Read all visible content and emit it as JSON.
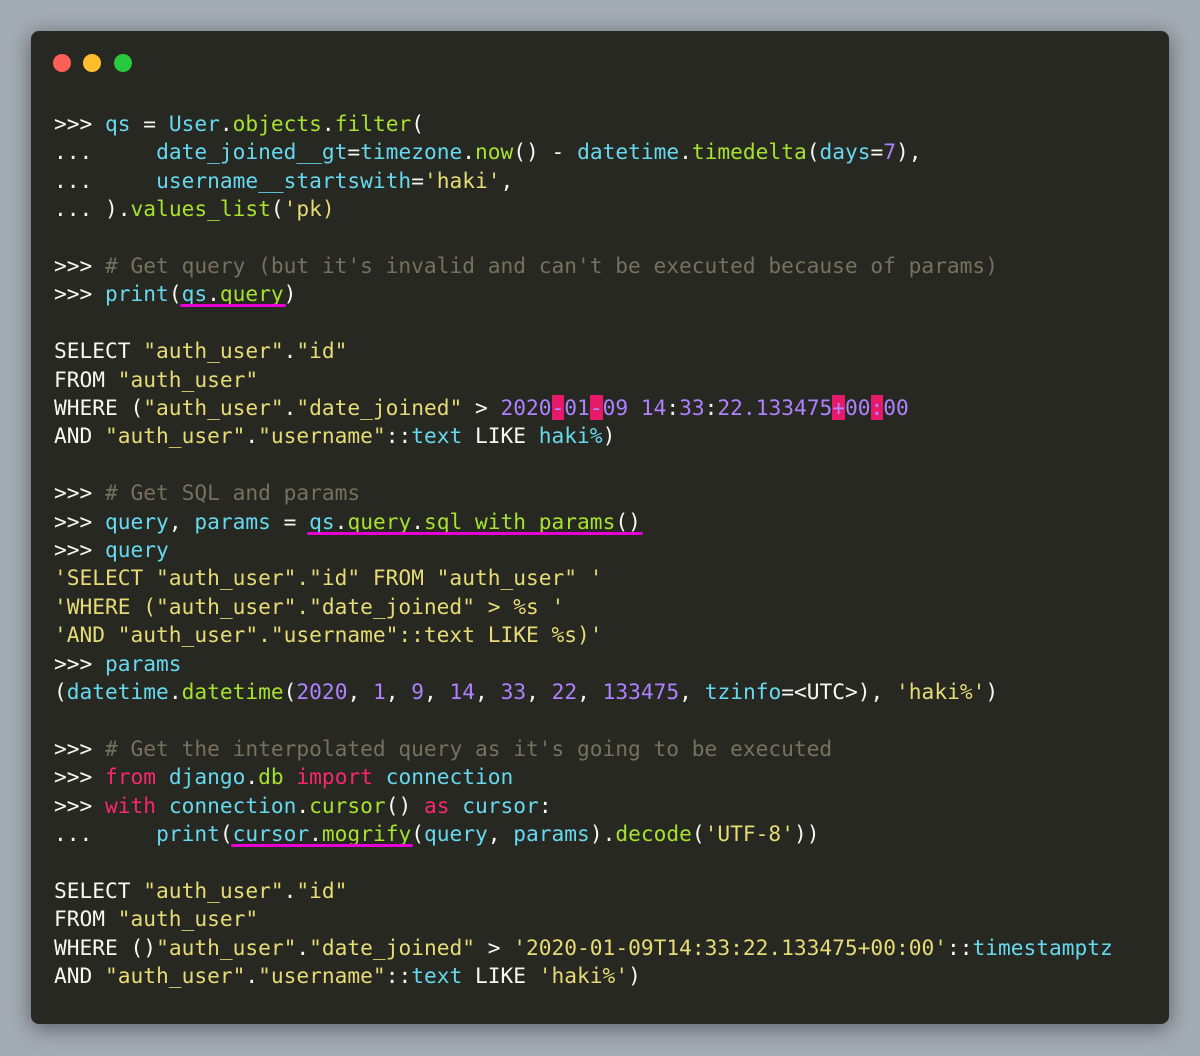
{
  "window": {
    "controls": [
      "close",
      "minimize",
      "maximize"
    ]
  },
  "code_lines": [
    [
      [
        "pr",
        ">>> "
      ],
      [
        "cy",
        "qs"
      ],
      [
        "pr",
        " = "
      ],
      [
        "cy",
        "User"
      ],
      [
        "pr",
        "."
      ],
      [
        "gr",
        "objects"
      ],
      [
        "pr",
        "."
      ],
      [
        "gr",
        "filter"
      ],
      [
        "pr",
        "("
      ]
    ],
    [
      [
        "pr",
        "...     "
      ],
      [
        "cy",
        "date_joined__gt"
      ],
      [
        "pr",
        "="
      ],
      [
        "cy",
        "timezone"
      ],
      [
        "pr",
        "."
      ],
      [
        "gr",
        "now"
      ],
      [
        "pr",
        "() - "
      ],
      [
        "cy",
        "datetime"
      ],
      [
        "pr",
        "."
      ],
      [
        "gr",
        "timedelta"
      ],
      [
        "pr",
        "("
      ],
      [
        "cy",
        "days"
      ],
      [
        "pr",
        "="
      ],
      [
        "pu",
        "7"
      ],
      [
        "pr",
        "),"
      ]
    ],
    [
      [
        "pr",
        "...     "
      ],
      [
        "cy",
        "username__startswith"
      ],
      [
        "pr",
        "="
      ],
      [
        "yl",
        "'haki'"
      ],
      [
        "pr",
        ","
      ]
    ],
    [
      [
        "pr",
        "... )."
      ],
      [
        "gr",
        "values_list"
      ],
      [
        "pr",
        "("
      ],
      [
        "yl",
        "'pk)"
      ]
    ],
    [],
    [
      [
        "pr",
        ">>> "
      ],
      [
        "cm",
        "# Get query (but it's invalid and can't be executed because of params)"
      ]
    ],
    [
      [
        "pr",
        ">>> "
      ],
      [
        "cy",
        "print"
      ],
      [
        "pr",
        "("
      ],
      [
        "cy",
        "qs"
      ],
      [
        "pr",
        "."
      ],
      [
        "gr",
        "query"
      ],
      [
        "pr",
        ")"
      ]
    ],
    [],
    [
      [
        "pr",
        "SELECT "
      ],
      [
        "yl",
        "\"auth_user\""
      ],
      [
        "pr",
        "."
      ],
      [
        "yl",
        "\"id\""
      ]
    ],
    [
      [
        "pr",
        "FROM "
      ],
      [
        "yl",
        "\"auth_user\""
      ]
    ],
    [
      [
        "pr",
        "WHERE ("
      ],
      [
        "yl",
        "\"auth_user\""
      ],
      [
        "pr",
        "."
      ],
      [
        "yl",
        "\"date_joined\""
      ],
      [
        "pr",
        " > "
      ],
      [
        "pu",
        "2020"
      ],
      [
        "hl",
        "-"
      ],
      [
        "pu",
        "01"
      ],
      [
        "hl",
        "-"
      ],
      [
        "pu",
        "09"
      ],
      [
        "pr",
        " "
      ],
      [
        "pu",
        "14"
      ],
      [
        "pr",
        ":"
      ],
      [
        "pu",
        "33"
      ],
      [
        "pr",
        ":"
      ],
      [
        "pu",
        "22.133475"
      ],
      [
        "hl",
        "+"
      ],
      [
        "pu",
        "00"
      ],
      [
        "hl",
        ":"
      ],
      [
        "pu",
        "00"
      ]
    ],
    [
      [
        "pr",
        "AND "
      ],
      [
        "yl",
        "\"auth_user\""
      ],
      [
        "pr",
        "."
      ],
      [
        "yl",
        "\"username\""
      ],
      [
        "pr",
        "::"
      ],
      [
        "cy",
        "text"
      ],
      [
        "pr",
        " LIKE "
      ],
      [
        "cy",
        "haki%"
      ],
      [
        "pr",
        ")"
      ]
    ],
    [],
    [
      [
        "pr",
        ">>> "
      ],
      [
        "cm",
        "# Get SQL and params"
      ]
    ],
    [
      [
        "pr",
        ">>> "
      ],
      [
        "cy",
        "query"
      ],
      [
        "pr",
        ", "
      ],
      [
        "cy",
        "params"
      ],
      [
        "pr",
        " = "
      ],
      [
        "cy",
        "qs"
      ],
      [
        "pr",
        "."
      ],
      [
        "gr",
        "query"
      ],
      [
        "pr",
        "."
      ],
      [
        "gr",
        "sql_with_params"
      ],
      [
        "pr",
        "()"
      ]
    ],
    [
      [
        "pr",
        ">>> "
      ],
      [
        "cy",
        "query"
      ]
    ],
    [
      [
        "yl",
        "'SELECT \"auth_user\".\"id\" FROM \"auth_user\" '"
      ]
    ],
    [
      [
        "yl",
        "'WHERE (\"auth_user\".\"date_joined\" > %s '"
      ]
    ],
    [
      [
        "yl",
        "'AND \"auth_user\".\"username\"::text LIKE %s)'"
      ]
    ],
    [
      [
        "pr",
        ">>> "
      ],
      [
        "cy",
        "params"
      ]
    ],
    [
      [
        "pr",
        "("
      ],
      [
        "cy",
        "datetime"
      ],
      [
        "pr",
        "."
      ],
      [
        "gr",
        "datetime"
      ],
      [
        "pr",
        "("
      ],
      [
        "pu",
        "2020"
      ],
      [
        "pr",
        ", "
      ],
      [
        "pu",
        "1"
      ],
      [
        "pr",
        ", "
      ],
      [
        "pu",
        "9"
      ],
      [
        "pr",
        ", "
      ],
      [
        "pu",
        "14"
      ],
      [
        "pr",
        ", "
      ],
      [
        "pu",
        "33"
      ],
      [
        "pr",
        ", "
      ],
      [
        "pu",
        "22"
      ],
      [
        "pr",
        ", "
      ],
      [
        "pu",
        "133475"
      ],
      [
        "pr",
        ", "
      ],
      [
        "cy",
        "tzinfo"
      ],
      [
        "pr",
        "=<UTC>), "
      ],
      [
        "yl",
        "'haki%'"
      ],
      [
        "pr",
        ")"
      ]
    ],
    [],
    [
      [
        "pr",
        ">>> "
      ],
      [
        "cm",
        "# Get the interpolated query as it's going to be executed"
      ]
    ],
    [
      [
        "pr",
        ">>> "
      ],
      [
        "pk",
        "from"
      ],
      [
        "pr",
        " "
      ],
      [
        "cy",
        "django"
      ],
      [
        "pr",
        "."
      ],
      [
        "gr",
        "db"
      ],
      [
        "pr",
        " "
      ],
      [
        "pk",
        "import"
      ],
      [
        "pr",
        " "
      ],
      [
        "cy",
        "connection"
      ]
    ],
    [
      [
        "pr",
        ">>> "
      ],
      [
        "pk",
        "with"
      ],
      [
        "pr",
        " "
      ],
      [
        "cy",
        "connection"
      ],
      [
        "pr",
        "."
      ],
      [
        "gr",
        "cursor"
      ],
      [
        "pr",
        "() "
      ],
      [
        "pk",
        "as"
      ],
      [
        "pr",
        " "
      ],
      [
        "cy",
        "cursor"
      ],
      [
        "pr",
        ":"
      ]
    ],
    [
      [
        "pr",
        "...     "
      ],
      [
        "cy",
        "print"
      ],
      [
        "pr",
        "("
      ],
      [
        "cy",
        "cursor"
      ],
      [
        "pr",
        "."
      ],
      [
        "gr",
        "mogrify"
      ],
      [
        "pr",
        "("
      ],
      [
        "cy",
        "query"
      ],
      [
        "pr",
        ", "
      ],
      [
        "cy",
        "params"
      ],
      [
        "pr",
        ")."
      ],
      [
        "gr",
        "decode"
      ],
      [
        "pr",
        "("
      ],
      [
        "yl",
        "'UTF-8'"
      ],
      [
        "pr",
        "))"
      ]
    ],
    [],
    [
      [
        "pr",
        "SELECT "
      ],
      [
        "yl",
        "\"auth_user\""
      ],
      [
        "pr",
        "."
      ],
      [
        "yl",
        "\"id\""
      ]
    ],
    [
      [
        "pr",
        "FROM "
      ],
      [
        "yl",
        "\"auth_user\""
      ]
    ],
    [
      [
        "pr",
        "WHERE ()"
      ],
      [
        "yl",
        "\"auth_user\""
      ],
      [
        "pr",
        "."
      ],
      [
        "yl",
        "\"date_joined\""
      ],
      [
        "pr",
        " > "
      ],
      [
        "yl",
        "'2020-01-09T14:33:22.133475+00:00'"
      ],
      [
        "pr",
        "::"
      ],
      [
        "cy",
        "timestamptz"
      ]
    ],
    [
      [
        "pr",
        "AND "
      ],
      [
        "yl",
        "\"auth_user\""
      ],
      [
        "pr",
        "."
      ],
      [
        "yl",
        "\"username\""
      ],
      [
        "pr",
        "::"
      ],
      [
        "cy",
        "text"
      ],
      [
        "pr",
        " LIKE "
      ],
      [
        "yl",
        "'haki%'"
      ],
      [
        "pr",
        ")"
      ]
    ]
  ],
  "underlines": [
    {
      "line": 6,
      "text": "qs.query"
    },
    {
      "line": 14,
      "text": "qs.query.sql_with_params()"
    },
    {
      "line": 25,
      "text": "cursor.mogrify"
    }
  ],
  "colors": {
    "background": "#272822",
    "underline": "#e600d4",
    "highlight": "#e6196b"
  }
}
